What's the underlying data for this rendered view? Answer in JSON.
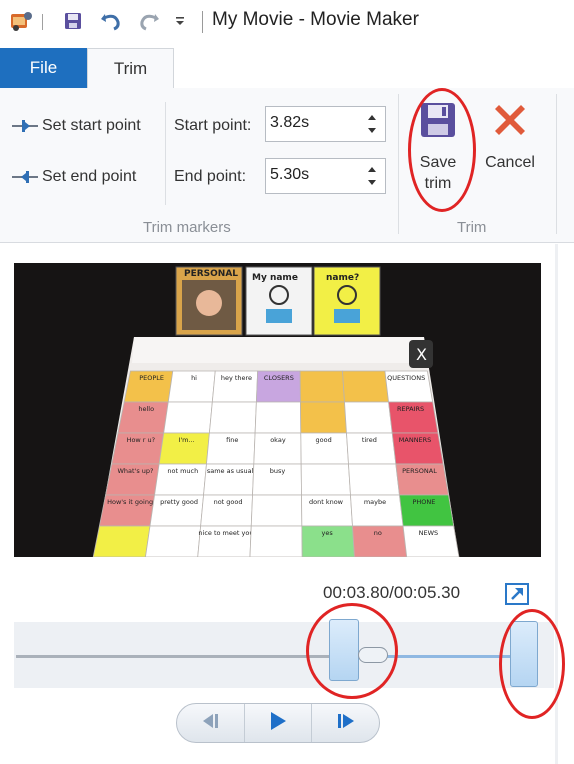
{
  "window": {
    "title": "My Movie - Movie Maker"
  },
  "tabs": [
    {
      "label": "File"
    },
    {
      "label": "Trim"
    }
  ],
  "ribbon": {
    "set_start_label": "Set start point",
    "set_end_label": "Set end point",
    "start_point_label": "Start point:",
    "end_point_label": "End point:",
    "start_point_value": "3.82s",
    "end_point_value": "5.30s",
    "trim_markers_group": "Trim markers",
    "save_trim_line1": "Save",
    "save_trim_line2": "trim",
    "cancel_label": "Cancel",
    "trim_group": "Trim"
  },
  "preview": {
    "timecode": "00:03.80/00:05.30",
    "board_tabs": [
      "PERSONAL",
      "My name",
      "name?"
    ],
    "board_rows": [
      [
        "PEOPLE",
        "hi",
        "hey there",
        "CLOSERS",
        "",
        "",
        "QUESTIONS"
      ],
      [
        "hello",
        "",
        "",
        "",
        "",
        "",
        "REPAIRS"
      ],
      [
        "How r u?",
        "I'm...",
        "fine",
        "okay",
        "good",
        "tired",
        "MANNERS"
      ],
      [
        "What's up?",
        "not much",
        "same as usual",
        "busy",
        "",
        "",
        "PERSONAL"
      ],
      [
        "How's it going",
        "pretty good",
        "not good",
        "",
        "dont know",
        "maybe",
        "PHONE"
      ],
      [
        "",
        "",
        "nice to meet you",
        "",
        "yes",
        "no",
        "NEWS"
      ]
    ]
  },
  "timeline": {
    "trim_start_fraction": 0.68,
    "trim_end_fraction": 1.0,
    "playhead_fraction": 0.72
  }
}
